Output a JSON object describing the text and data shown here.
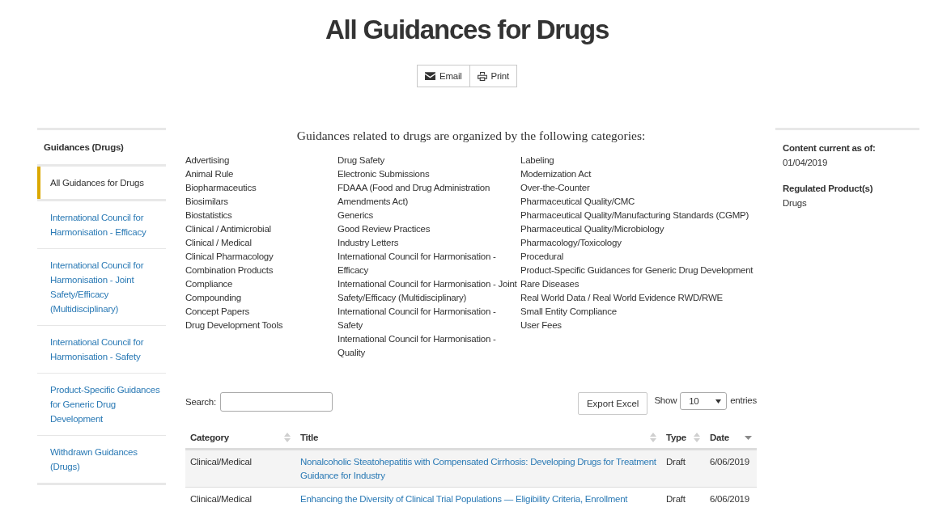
{
  "page_title": "All Guidances for Drugs",
  "share_buttons": [
    {
      "kind": "email",
      "label": "Email"
    },
    {
      "kind": "print",
      "label": "Print"
    }
  ],
  "sidebar": {
    "heading": "Guidances (Drugs)",
    "items": [
      {
        "label": "All Guidances for Drugs",
        "selected": true
      },
      {
        "label": "International Council for Harmonisation - Efficacy",
        "selected": false
      },
      {
        "label": "International Council for Harmonisation - Joint Safety/Efficacy (Multidisciplinary)",
        "selected": false
      },
      {
        "label": "International Council for Harmonisation - Safety",
        "selected": false
      },
      {
        "label": "Product-Specific Guidances for Generic Drug Development",
        "selected": false
      },
      {
        "label": "Withdrawn Guidances (Drugs)",
        "selected": false
      }
    ]
  },
  "categories": {
    "heading": "Guidances related to drugs are organized by the following categories:",
    "columns": [
      [
        "Advertising",
        "Animal Rule",
        "Biopharmaceutics",
        "Biosimilars",
        "Biostatistics",
        "Clinical / Antimicrobial",
        "Clinical / Medical",
        "Clinical Pharmacology",
        "Combination Products",
        "Compliance",
        "Compounding",
        "Concept Papers",
        "Drug Development Tools"
      ],
      [
        "Drug Safety",
        "Electronic Submissions",
        "FDAAA (Food and Drug Administration Amendments Act)",
        "Generics",
        "Good Review Practices",
        "Industry Letters",
        "International Council for Harmonisation - Efficacy",
        "International Council for Harmonisation - Joint Safety/Efficacy (Multidisciplinary)",
        "International Council for Harmonisation - Safety",
        "International Council for Harmonisation - Quality"
      ],
      [
        "Labeling",
        "Modernization Act",
        "Over-the-Counter",
        "Pharmaceutical Quality/CMC",
        "Pharmaceutical Quality/Manufacturing Standards (CGMP)",
        "Pharmaceutical Quality/Microbiology",
        "Pharmacology/Toxicology",
        "Procedural",
        "Product-Specific Guidances for Generic Drug Development",
        "Rare Diseases",
        "Real World Data / Real World Evidence RWD/RWE",
        "Small Entity Compliance",
        "User Fees"
      ]
    ]
  },
  "table_controls": {
    "search_label": "Search:",
    "export_button": "Export Excel",
    "show_label": "Show",
    "page_size": "10",
    "entries_label": "entries"
  },
  "table": {
    "columns": [
      {
        "label": "Category",
        "sorted": false
      },
      {
        "label": "Title",
        "sorted": false
      },
      {
        "label": "Type",
        "sorted": false
      },
      {
        "label": "Date",
        "sorted": true
      }
    ],
    "rows": [
      {
        "category": "Clinical/Medical",
        "title": "Nonalcoholic Steatohepatitis with Compensated Cirrhosis: Developing Drugs for Treatment Guidance for Industry",
        "type": "Draft",
        "date": "6/06/2019"
      },
      {
        "category": "Clinical/Medical",
        "title": "Enhancing the Diversity of Clinical Trial Populations — Eligibility Criteria, Enrollment",
        "type": "Draft",
        "date": "6/06/2019"
      }
    ]
  },
  "details": [
    {
      "label": "Content current as of:",
      "value": "01/04/2019"
    },
    {
      "label": "Regulated Product(s)",
      "value": "Drugs"
    }
  ]
}
